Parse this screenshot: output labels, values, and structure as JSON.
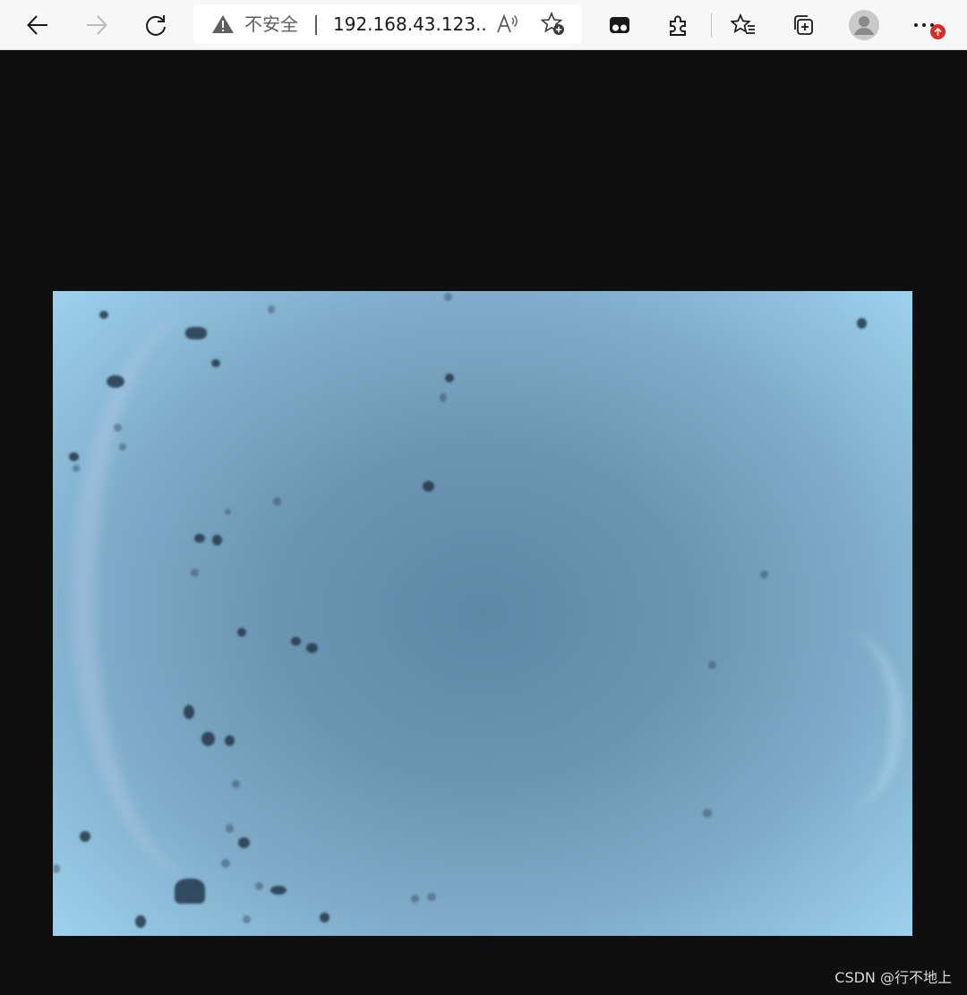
{
  "toolbar": {
    "back_icon": "arrow-left-icon",
    "forward_icon": "arrow-right-icon",
    "refresh_icon": "refresh-icon",
    "address": {
      "security_icon": "warning-triangle-icon",
      "security_text": "不安全",
      "url": "192.168.43.123...",
      "read_aloud_icon": "read-aloud-icon",
      "favorite_icon": "add-favorite-icon"
    },
    "extensions_icon": "puzzle-icon",
    "collections_icon": "collections-icon",
    "favorites_icon": "favorites-list-icon",
    "profile_icon": "avatar-icon",
    "menu_icon": "more-dots-icon",
    "update_badge_icon": "update-arrow-icon"
  },
  "content": {
    "stream_description": "camera-stream",
    "watermark": "CSDN @行不地上"
  },
  "colors": {
    "toolbar_bg": "#f7f7f7",
    "page_bg": "#0f0f0f",
    "badge": "#d62d20"
  }
}
